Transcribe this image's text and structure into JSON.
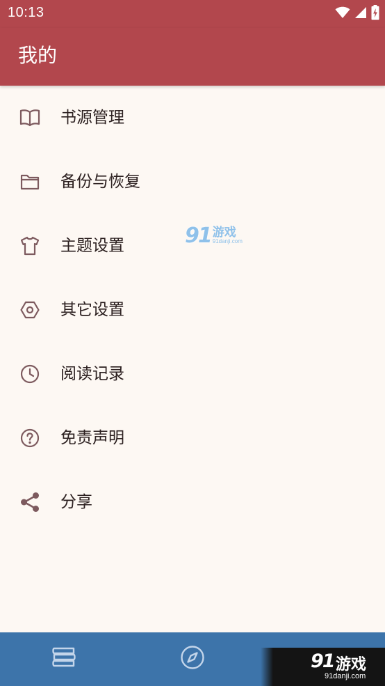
{
  "status_bar": {
    "time": "10:13",
    "icons": [
      "wifi-icon",
      "signal-icon",
      "battery-charging-icon"
    ]
  },
  "app_bar": {
    "title": "我的"
  },
  "menu": {
    "items": [
      {
        "label": "书源管理",
        "icon": "book-open-icon"
      },
      {
        "label": "备份与恢复",
        "icon": "folder-icon"
      },
      {
        "label": "主题设置",
        "icon": "tshirt-icon"
      },
      {
        "label": "其它设置",
        "icon": "hexagon-settings-icon"
      },
      {
        "label": "阅读记录",
        "icon": "clock-icon"
      },
      {
        "label": "免责声明",
        "icon": "help-circle-icon"
      },
      {
        "label": "分享",
        "icon": "share-icon"
      }
    ]
  },
  "bottom_nav": {
    "items": [
      {
        "icon": "bookshelf-icon"
      },
      {
        "icon": "compass-icon"
      }
    ]
  },
  "watermark": {
    "logo_number": "9",
    "logo_number_2": "1",
    "logo_text": "游戏",
    "url": "91danji.com",
    "corner_url": "91danji.com"
  },
  "colors": {
    "primary": "#b2474d",
    "background": "#fdf8f3",
    "icon": "#7d5a5e",
    "bottom_nav": "#3d74aa"
  }
}
